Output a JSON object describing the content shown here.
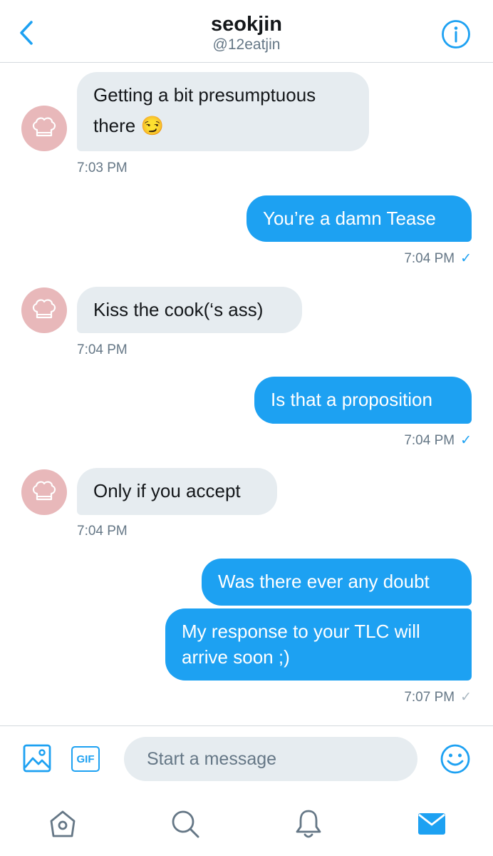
{
  "header": {
    "title": "seokjin",
    "handle": "@12eatjin"
  },
  "messages": [
    {
      "direction": "in",
      "lines": [
        "Getting a bit presumptuous",
        "there 😏"
      ],
      "time": "7:03 PM"
    },
    {
      "direction": "out",
      "text": "You’re a damn Tease",
      "time": "7:04 PM",
      "status": "read"
    },
    {
      "direction": "in",
      "text": "Kiss the cook(‘s ass)",
      "time": "7:04 PM"
    },
    {
      "direction": "out",
      "text": "Is that a proposition",
      "time": "7:04 PM",
      "status": "read"
    },
    {
      "direction": "in",
      "text": "Only if you accept",
      "time": "7:04 PM"
    },
    {
      "direction": "out",
      "text": "Was there ever any doubt"
    },
    {
      "direction": "out",
      "lines": [
        "My response to your TLC will",
        "arrive soon ;)"
      ],
      "time": "7:07 PM",
      "status": "sent"
    }
  ],
  "composer": {
    "gif_label": "GIF",
    "placeholder": "Start a message"
  },
  "icons": {
    "back": "chevron-left-icon",
    "info": "info-icon",
    "image": "image-icon",
    "emoji": "smiley-icon",
    "home": "home-icon",
    "search": "search-icon",
    "notifications": "bell-icon",
    "messages": "mail-icon"
  },
  "colors": {
    "accent": "#1da1f2",
    "incoming_bubble": "#e6ecf0",
    "secondary_text": "#657786",
    "avatar": "#e8b8ba"
  }
}
